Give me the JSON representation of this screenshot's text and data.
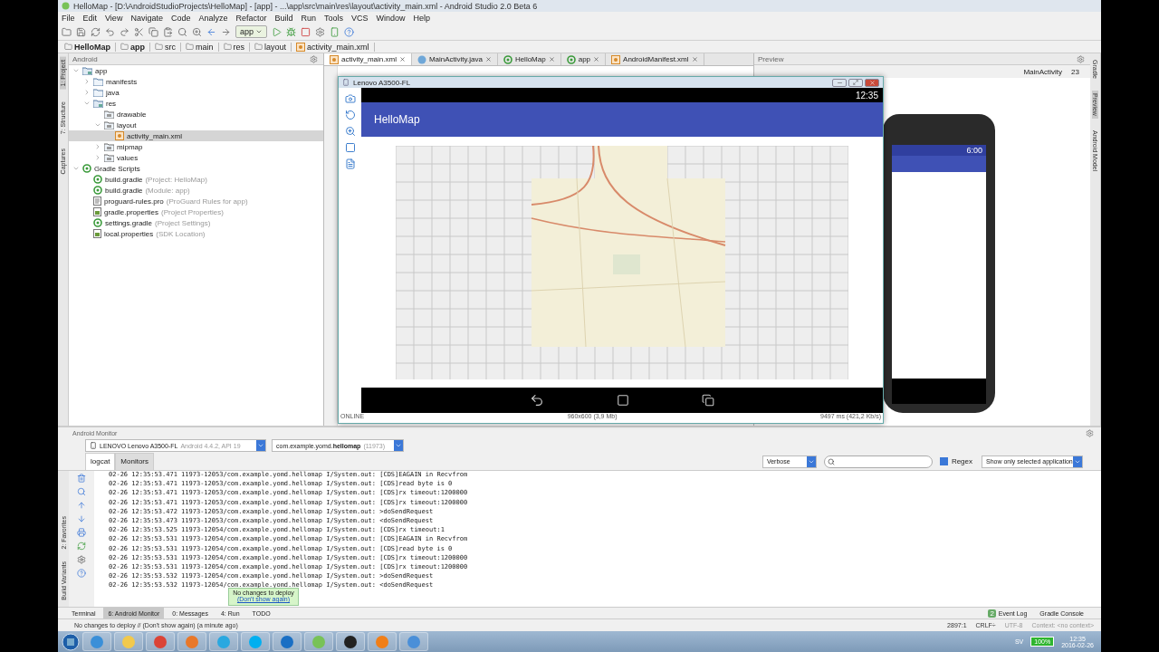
{
  "window": {
    "title": "HelloMap - [D:\\AndroidStudioProjects\\HelloMap] - [app] - ...\\app\\src\\main\\res\\layout\\activity_main.xml - Android Studio 2.0 Beta 6"
  },
  "menu": [
    "File",
    "Edit",
    "View",
    "Navigate",
    "Code",
    "Analyze",
    "Refactor",
    "Build",
    "Run",
    "Tools",
    "VCS",
    "Window",
    "Help"
  ],
  "toolbar": {
    "run_config": "app"
  },
  "breadcrumbs": [
    "HelloMap",
    "app",
    "src",
    "main",
    "res",
    "layout",
    "activity_main.xml"
  ],
  "left_tool_tabs": [
    {
      "label": "1: Project",
      "selected": true
    },
    {
      "label": "7: Structure",
      "selected": false
    },
    {
      "label": "Captures",
      "selected": false
    }
  ],
  "left_tool_tabs_bottom": [
    {
      "label": "2: Favorites",
      "selected": false
    },
    {
      "label": "Build Variants",
      "selected": false
    }
  ],
  "right_tool_tabs": [
    {
      "label": "Gradle",
      "selected": false
    },
    {
      "label": "Preview",
      "selected": true
    },
    {
      "label": "Android Model",
      "selected": false
    }
  ],
  "project": {
    "view": "Android",
    "tree": [
      {
        "label": "app",
        "kind": "module",
        "expanded": true,
        "selected": false,
        "children": [
          {
            "label": "manifests",
            "kind": "folder",
            "expanded": false,
            "selected": false
          },
          {
            "label": "java",
            "kind": "folder",
            "expanded": false,
            "selected": false
          },
          {
            "label": "res",
            "kind": "module",
            "expanded": true,
            "selected": false,
            "children": [
              {
                "label": "drawable",
                "kind": "resfolder",
                "selected": false
              },
              {
                "label": "layout",
                "kind": "resfolder",
                "expanded": true,
                "selected": false,
                "children": [
                  {
                    "label": "activity_main.xml",
                    "kind": "xml",
                    "selected": true
                  }
                ]
              },
              {
                "label": "mipmap",
                "kind": "resfolder",
                "expanded": false,
                "selected": false
              },
              {
                "label": "values",
                "kind": "resfolder",
                "expanded": false,
                "selected": false
              }
            ]
          }
        ]
      },
      {
        "label": "Gradle Scripts",
        "kind": "gradle",
        "expanded": true,
        "selected": false,
        "children": [
          {
            "label": "build.gradle",
            "hint": "(Project: HelloMap)",
            "kind": "gradle",
            "selected": false
          },
          {
            "label": "build.gradle",
            "hint": "(Module: app)",
            "kind": "gradle",
            "selected": false
          },
          {
            "label": "proguard-rules.pro",
            "hint": "(ProGuard Rules for app)",
            "kind": "text",
            "selected": false
          },
          {
            "label": "gradle.properties",
            "hint": "(Project Properties)",
            "kind": "props",
            "selected": false
          },
          {
            "label": "settings.gradle",
            "hint": "(Project Settings)",
            "kind": "gradle",
            "selected": false
          },
          {
            "label": "local.properties",
            "hint": "(SDK Location)",
            "kind": "props",
            "selected": false
          }
        ]
      }
    ]
  },
  "editor_tabs": [
    {
      "label": "activity_main.xml",
      "kind": "xml",
      "selected": true
    },
    {
      "label": "MainActivity.java",
      "kind": "java",
      "selected": false
    },
    {
      "label": "HelloMap",
      "kind": "run",
      "selected": false
    },
    {
      "label": "app",
      "kind": "run",
      "selected": false
    },
    {
      "label": "AndroidManifest.xml",
      "kind": "xml",
      "selected": false
    }
  ],
  "preview": {
    "title": "Preview",
    "activity": "MainActivity",
    "api": "23",
    "phone_time": "6:00"
  },
  "mirror": {
    "title": "Lenovo A3500-FL",
    "time": "12:35",
    "app_title": "HelloMap",
    "status": "ONLINE",
    "resolution": "960x600 (3,9 Mb)",
    "timing": "9497 ms (421,2 Kb/s)"
  },
  "monitor": {
    "title": "Android Monitor",
    "device": {
      "name": "LENOVO Lenovo A3500-FL",
      "detail": "Android 4.4.2, API 19"
    },
    "process": {
      "name": "com.example.yomd.**hellomap**",
      "pid": "(11973)"
    },
    "tabs": [
      {
        "label": "logcat",
        "selected": true
      },
      {
        "label": "Monitors",
        "selected": false
      }
    ],
    "level": "Verbose",
    "regex": {
      "label": "Regex",
      "checked": true
    },
    "filter": "Show only selected application",
    "log": [
      "02-26 12:35:53.471 11973-12053/com.example.yomd.hellomap I/System.out: [CDS]EAGAIN in Recvfrom",
      "02-26 12:35:53.471 11973-12053/com.example.yomd.hellomap I/System.out: [CDS]read byte is 0",
      "02-26 12:35:53.471 11973-12053/com.example.yomd.hellomap I/System.out: [CDS]rx timeout:1200000",
      "02-26 12:35:53.471 11973-12053/com.example.yomd.hellomap I/System.out: [CDS]rx timeout:1200000",
      "02-26 12:35:53.472 11973-12053/com.example.yomd.hellomap I/System.out: >doSendRequest",
      "02-26 12:35:53.473 11973-12053/com.example.yomd.hellomap I/System.out: <doSendRequest",
      "02-26 12:35:53.525 11973-12054/com.example.yomd.hellomap I/System.out: [CDS]rx timeout:1",
      "02-26 12:35:53.531 11973-12054/com.example.yomd.hellomap I/System.out: [CDS]EAGAIN in Recvfrom",
      "02-26 12:35:53.531 11973-12054/com.example.yomd.hellomap I/System.out: [CDS]read byte is 0",
      "02-26 12:35:53.531 11973-12054/com.example.yomd.hellomap I/System.out: [CDS]rx timeout:1200000",
      "02-26 12:35:53.531 11973-12054/com.example.yomd.hellomap I/System.out: [CDS]rx timeout:1200000",
      "02-26 12:35:53.532 11973-12054/com.example.yomd.hellomap I/System.out: >doSendRequest",
      "02-26 12:35:53.532 11973-12054/com.example.yomd.hellomap I/System.out: <doSendRequest"
    ]
  },
  "tooltip": {
    "message": "No changes to deploy",
    "link": "(Don't show again)"
  },
  "bottom_tabs": [
    {
      "label": "Terminal",
      "selected": false
    },
    {
      "label": "6: Android Monitor",
      "selected": true
    },
    {
      "label": "0: Messages",
      "selected": false
    },
    {
      "label": "4: Run",
      "selected": false
    },
    {
      "label": "TODO",
      "selected": false
    }
  ],
  "bottom_tabs_right": [
    {
      "label": "Event Log",
      "badge": "2"
    },
    {
      "label": "Gradle Console"
    }
  ],
  "status_bar": {
    "message": "No changes to deploy // (Don't show again) (a minute ago)",
    "position": "2897:1",
    "line_ending": "CRLF÷",
    "encoding": "UTF-8",
    "context": "Context: <no context>"
  },
  "taskbar": {
    "apps": [
      {
        "color": "#3a8fd8"
      },
      {
        "color": "#f2c94c"
      },
      {
        "color": "#db4437"
      },
      {
        "color": "#e8782a"
      },
      {
        "color": "#2aa8e0"
      },
      {
        "color": "#00aff0"
      },
      {
        "color": "#1a6fc4"
      },
      {
        "color": "#78c257"
      },
      {
        "color": "#222222"
      },
      {
        "color": "#f07f19"
      },
      {
        "color": "#4a8fd8"
      }
    ],
    "language": "SV",
    "battery": "100%",
    "time": "12:35",
    "date": "2016-02-26"
  }
}
